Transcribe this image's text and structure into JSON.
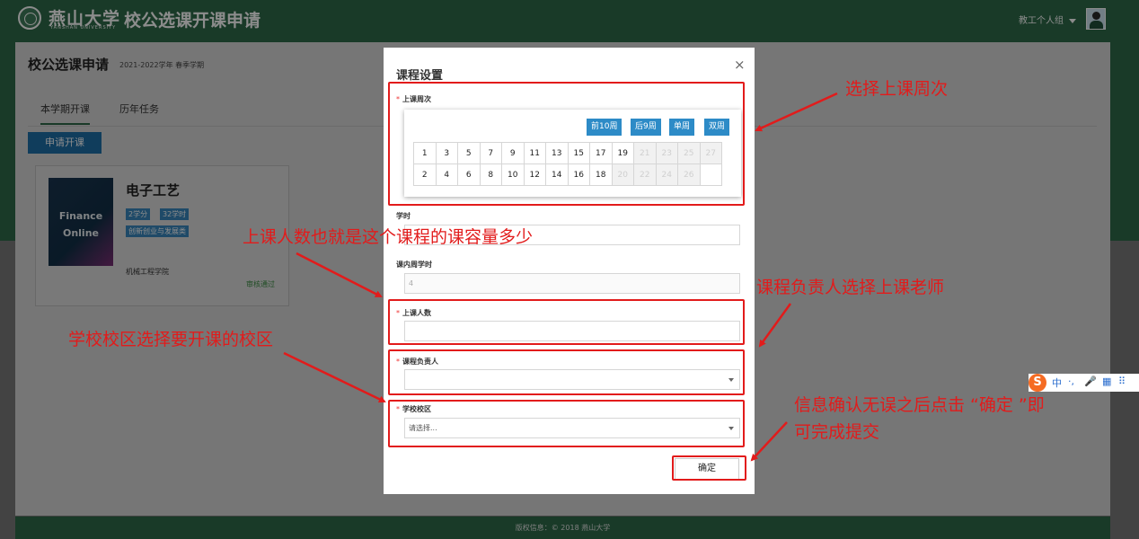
{
  "header": {
    "school_name": "燕山大学",
    "school_name_en": "YANSHAN UNIVERSITY",
    "system_title": "校公选课开课申请",
    "user_menu_label": "教工个人组"
  },
  "page": {
    "title": "校公选课申请",
    "term": "2021-2022学年 春季学期",
    "tabs": [
      "本学期开课",
      "历年任务"
    ],
    "apply_button": "申请开课"
  },
  "course_card": {
    "cover_text_line1": "Finance",
    "cover_text_line2": "Online",
    "name": "电子工艺",
    "credits": "2学分",
    "hours": "32学时",
    "category": "创新创业与发展类",
    "college": "机械工程学院",
    "status": "审核通过"
  },
  "modal": {
    "title": "课程设置",
    "close": "×",
    "weeks_label": "上课周次",
    "week_buttons": [
      "前10周",
      "后9周",
      "单周",
      "双周"
    ],
    "weeks_row_odd": [
      "1",
      "3",
      "5",
      "7",
      "9",
      "11",
      "13",
      "15",
      "17",
      "19",
      "21",
      "23",
      "25",
      "27"
    ],
    "weeks_row_even": [
      "2",
      "4",
      "6",
      "8",
      "10",
      "12",
      "14",
      "16",
      "18",
      "20",
      "22",
      "24",
      "26",
      ""
    ],
    "hours_label": "学时",
    "hours_value": "",
    "weekly_hours_label": "课内周学时",
    "weekly_hours_value": "4",
    "capacity_label": "上课人数",
    "capacity_value": "",
    "teacher_label": "课程负责人",
    "teacher_value": "",
    "campus_label": "学校校区",
    "campus_value": "请选择...",
    "ok_button": "确定",
    "required_mark": "*"
  },
  "annotations": {
    "weeks": "选择上课周次",
    "capacity": "上课人数也就是这个课程的课容量多少",
    "teacher": "课程负责人选择上课老师",
    "campus": "学校校区选择要开课的校区",
    "submit_line1": "信息确认无误之后点击 “确定 ”即",
    "submit_line2": "可完成提交"
  },
  "ime": {
    "logo": "S",
    "items": [
      "中",
      "·,",
      "🎤",
      "▦",
      "⠿"
    ]
  },
  "footer": {
    "copyright": "版权信息：© 2018 燕山大学"
  },
  "colors": {
    "brand_green": "#2e6b4a",
    "button_blue": "#2d8bc7",
    "annotation_red": "#e21b1b"
  }
}
